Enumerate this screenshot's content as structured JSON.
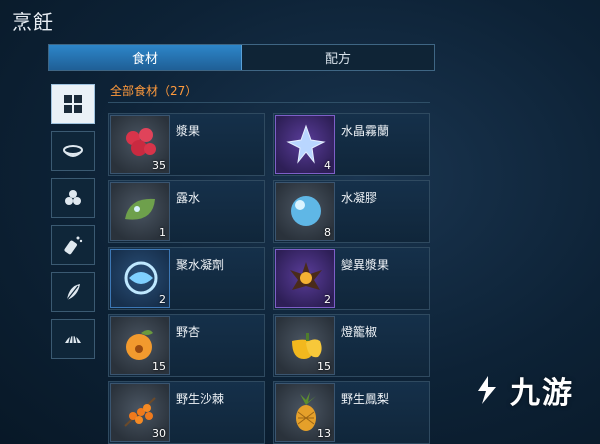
{
  "window": {
    "title": "烹飪"
  },
  "tabs": [
    {
      "label": "食材",
      "active": true
    },
    {
      "label": "配方",
      "active": false
    }
  ],
  "sidebar": {
    "items": [
      {
        "icon": "grid-icon",
        "active": true
      },
      {
        "icon": "bowl-icon",
        "active": false
      },
      {
        "icon": "fruit-icon",
        "active": false
      },
      {
        "icon": "salt-shaker-icon",
        "active": false
      },
      {
        "icon": "leaf-icon",
        "active": false
      },
      {
        "icon": "shell-icon",
        "active": false
      }
    ]
  },
  "category": {
    "title": "全部食材（27）"
  },
  "items": [
    {
      "name": "漿果",
      "count": "35",
      "rarity": "gray",
      "icon": "berries-icon"
    },
    {
      "name": "水晶霧蘭",
      "count": "4",
      "rarity": "purple",
      "icon": "crystal-flower-icon"
    },
    {
      "name": "露水",
      "count": "1",
      "rarity": "gray",
      "icon": "dew-leaf-icon"
    },
    {
      "name": "水凝膠",
      "count": "8",
      "rarity": "gray",
      "icon": "water-gel-icon"
    },
    {
      "name": "聚水凝劑",
      "count": "2",
      "rarity": "blue",
      "icon": "water-orb-icon"
    },
    {
      "name": "變異漿果",
      "count": "2",
      "rarity": "purple",
      "icon": "mutant-berry-icon"
    },
    {
      "name": "野杏",
      "count": "15",
      "rarity": "gray",
      "icon": "apricot-icon"
    },
    {
      "name": "燈籠椒",
      "count": "15",
      "rarity": "gray",
      "icon": "bell-pepper-icon"
    },
    {
      "name": "野生沙棘",
      "count": "30",
      "rarity": "gray",
      "icon": "sea-buckthorn-icon"
    },
    {
      "name": "野生鳳梨",
      "count": "13",
      "rarity": "gray",
      "icon": "pineapple-icon"
    }
  ],
  "watermark": {
    "text": "九游"
  },
  "colors": {
    "accent": "#ff9a3c",
    "tab_active": "#2d86c9",
    "background": "#0d2236"
  }
}
